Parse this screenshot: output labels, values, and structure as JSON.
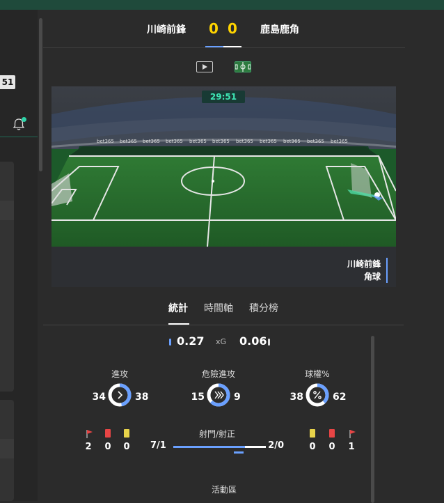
{
  "left_panel": {
    "clock_fragment": "51"
  },
  "match": {
    "home_team": "川崎前鋒",
    "away_team": "鹿島鹿角",
    "home_score": "0",
    "away_score": "0"
  },
  "pitch": {
    "clock": "29:51",
    "event_team": "川崎前鋒",
    "event_type": "角球",
    "sponsor": "bet365"
  },
  "stats_tabs": [
    "統計",
    "時間軸",
    "積分榜"
  ],
  "xg": {
    "home": "0.27",
    "label": "xG",
    "away": "0.06"
  },
  "stats": [
    {
      "title": "進攻",
      "home": "34",
      "away": "38",
      "icon": "chevron-right-icon",
      "home_share": 0.47
    },
    {
      "title": "危險進攻",
      "home": "15",
      "away": "9",
      "icon": "double-chevron-icon",
      "home_share": 0.63
    },
    {
      "title": "球權%",
      "home": "38",
      "away": "62",
      "icon": "percent-icon",
      "home_share": 0.38
    }
  ],
  "cards_home": {
    "corners": "2",
    "red": "0",
    "yellow": "0"
  },
  "cards_away": {
    "yellow": "0",
    "red": "0",
    "corners": "1"
  },
  "shots": {
    "title": "射門/射正",
    "home": "7/1",
    "away": "2/0"
  },
  "activity_title": "活動區",
  "colors": {
    "accent": "#6aa0ff",
    "score": "#ffd400",
    "clock": "#3ee6b4",
    "red_card": "#e84545",
    "yellow_card": "#e8d34a",
    "corner_flag": "#e84545"
  }
}
